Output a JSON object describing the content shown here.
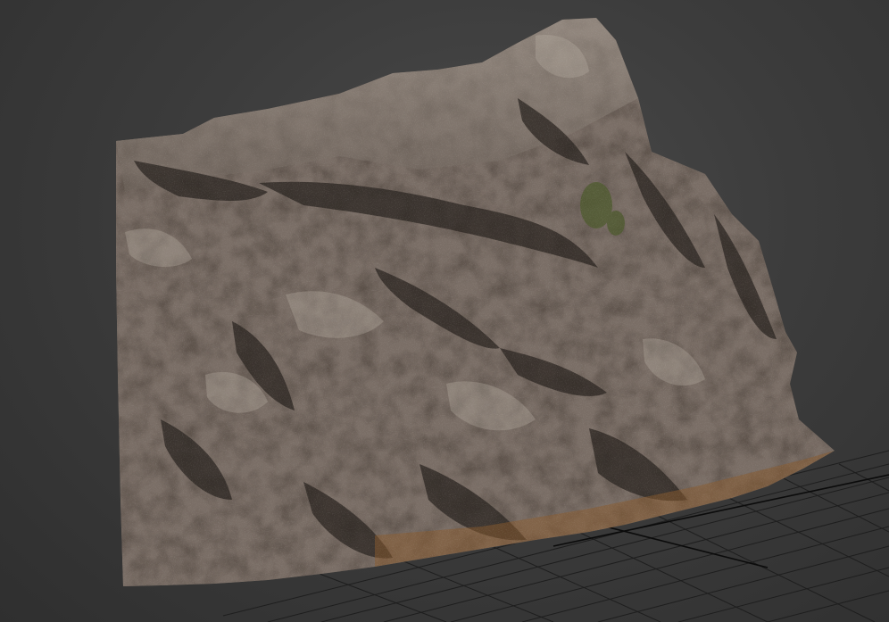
{
  "viewport": {
    "background_color": "#3c3c3c",
    "grid_color": "#1c1c1c",
    "grid_axis_color": "#0a0a0a",
    "object": {
      "kind": "scanned-rock-mesh",
      "base_color": "#7a6e66",
      "shadow_color": "#2a2420",
      "highlight_color": "#b8aea4",
      "vegetation_color": "#4f5a30"
    }
  }
}
